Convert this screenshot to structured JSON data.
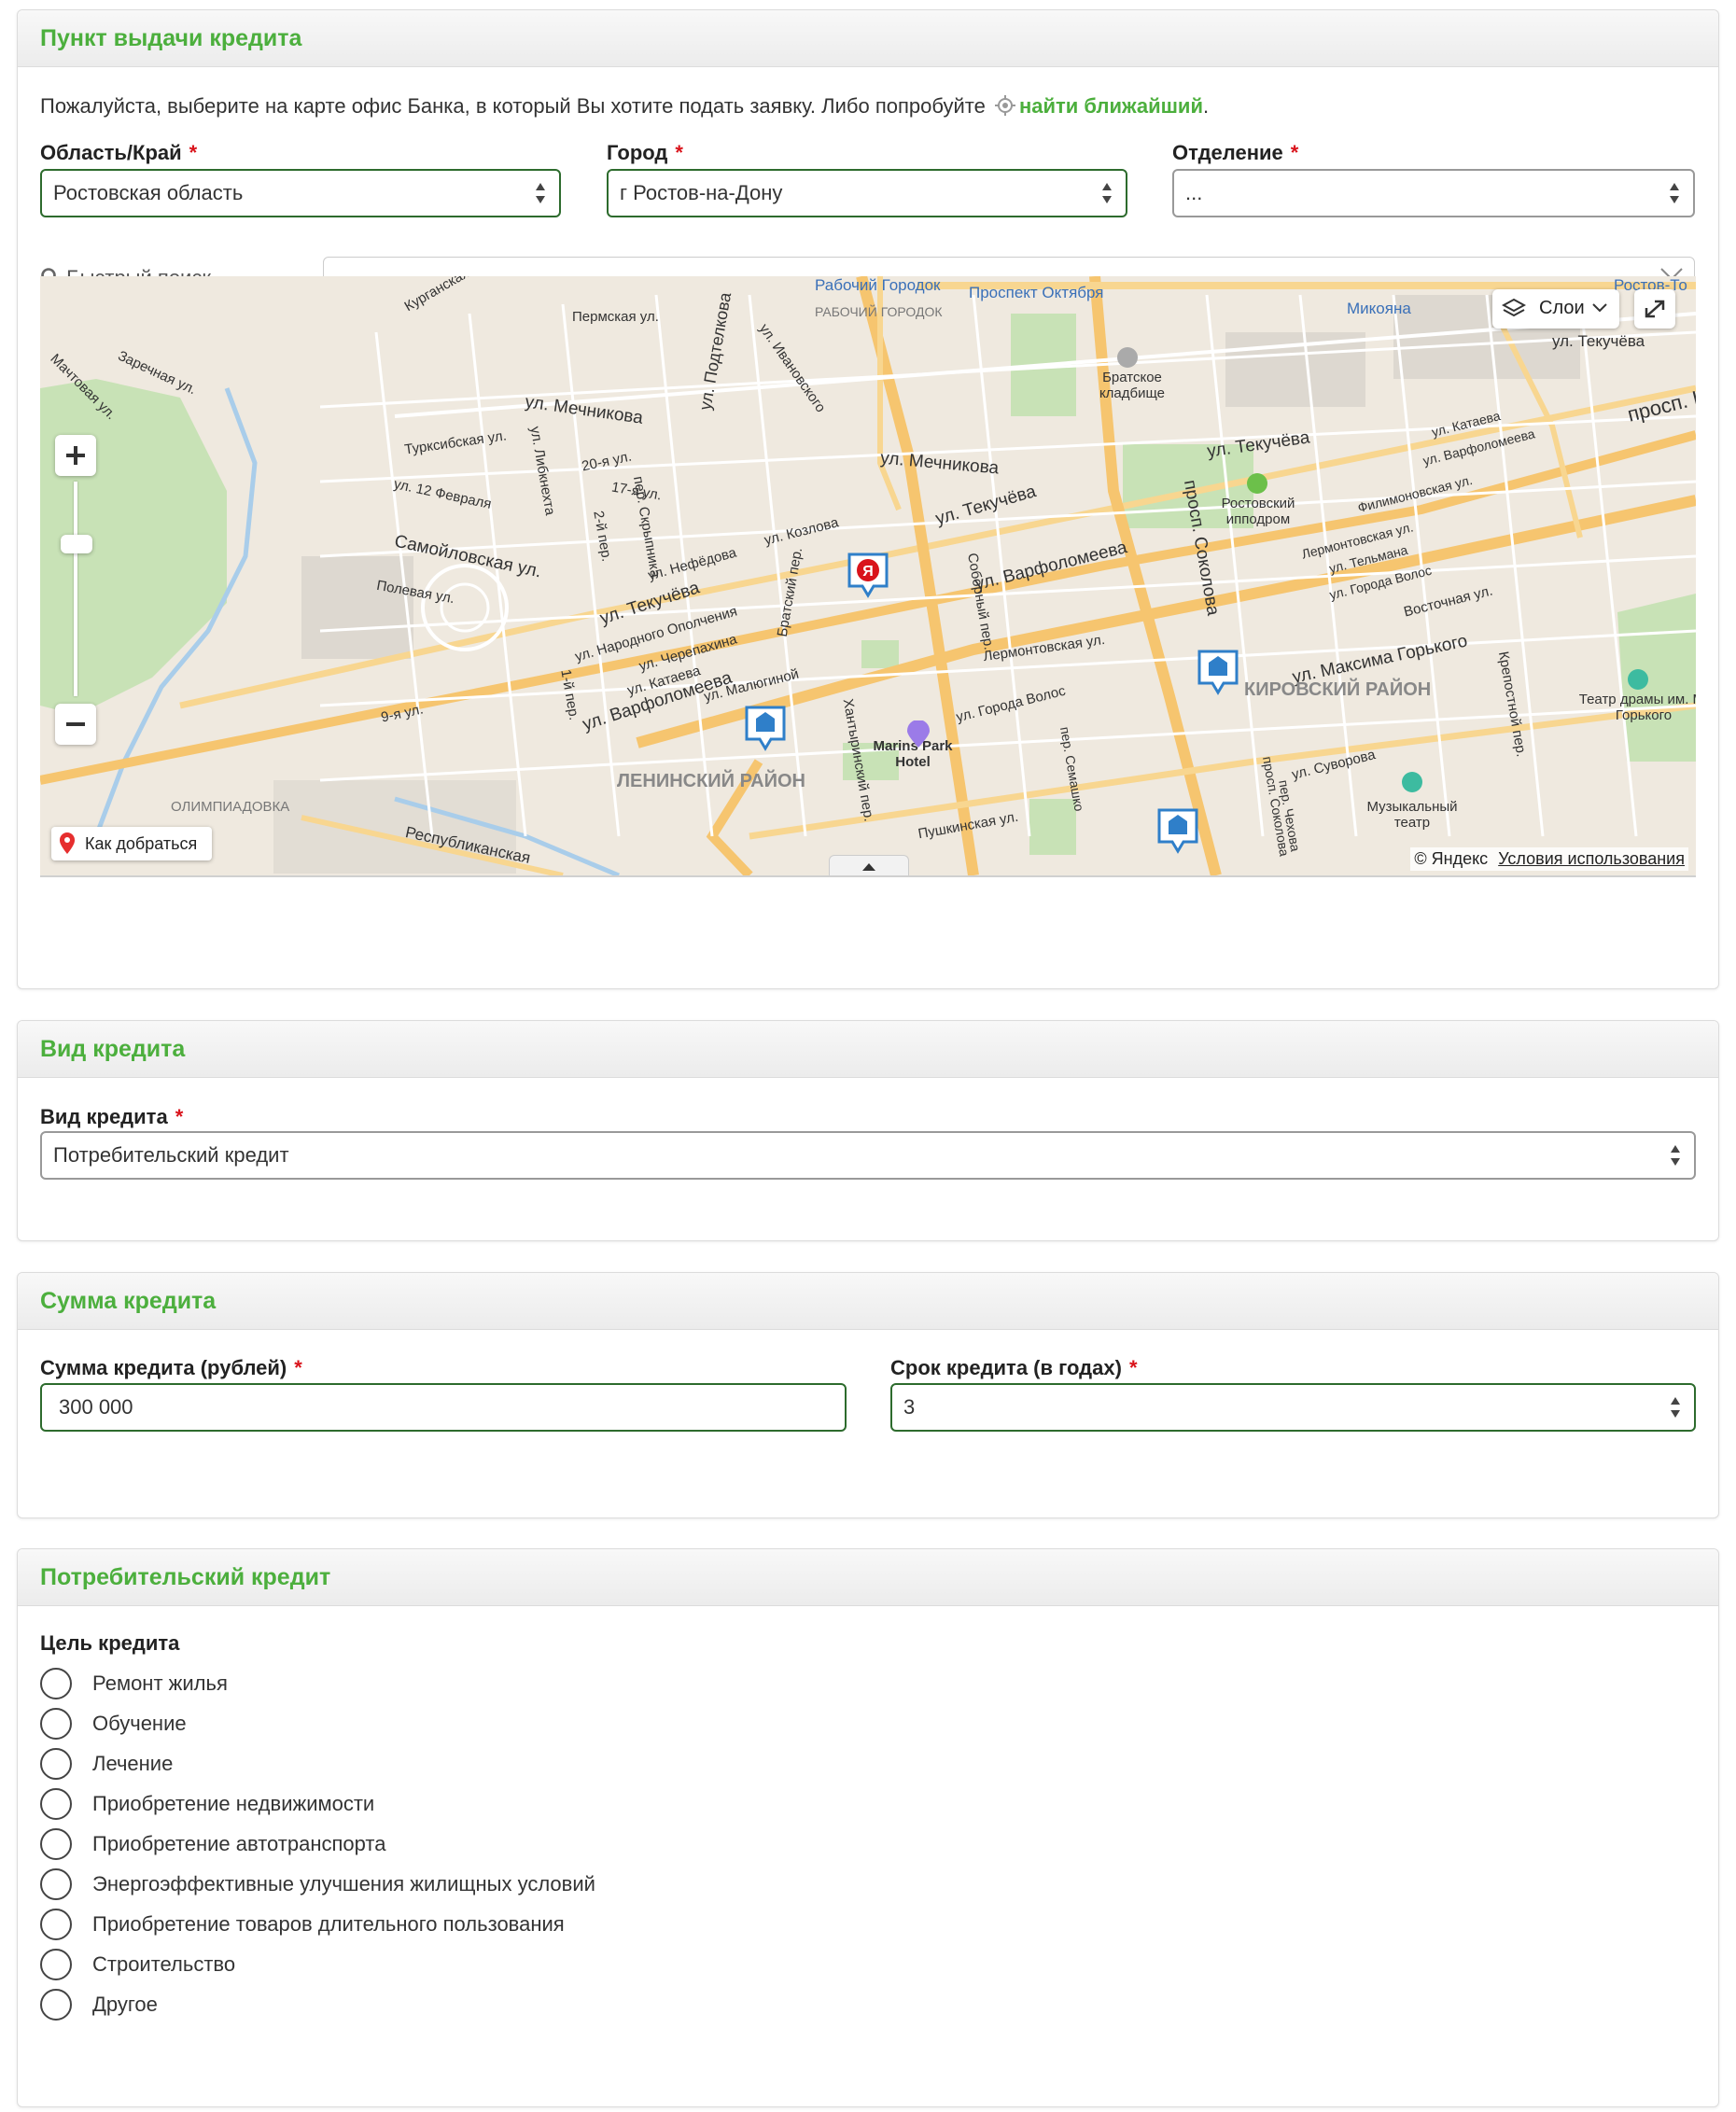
{
  "office_panel": {
    "title": "Пункт выдачи кредита",
    "intro_text": "Пожалуйста, выберите на карте офис Банка, в который Вы хотите подать заявку. Либо попробуйте",
    "find_nearest_label": "найти ближайший",
    "intro_end": ".",
    "region": {
      "label": "Область/Край",
      "value": "Ростовская область"
    },
    "city": {
      "label": "Город",
      "value": "г Ростов-на-Дону"
    },
    "branch": {
      "label": "Отделение",
      "value": "..."
    },
    "quick_search": {
      "label": "Быстрый поиск",
      "value": "..."
    },
    "required_mark": "*",
    "map": {
      "layers_label": "Слои",
      "route_label": "Как добраться",
      "copyright": "© Яндекс",
      "terms": "Условия использования",
      "streets": [
        "ул. Мечникова",
        "ул. Мечникова",
        "ул. Текучёва",
        "ул. Текучёва",
        "ул. Текучёва",
        "ул. Текучёва",
        "ул. Варфоломеева",
        "ул. Варфоломеева",
        "ул. Максима Горького",
        "просп. Соколова",
        "просп. Соколова",
        "Самойловская ул.",
        "ул. Подтелкова",
        "Пермская ул.",
        "ул. Ивановского",
        "Рабочий Городок",
        "Проспект Октября",
        "Микояна",
        "Ростов-То",
        "Братское кладбище",
        "Ростовский ипподром",
        "КИРОВСКИЙ РАЙОН",
        "ЛЕНИНСКИЙ РАЙОН",
        "Marins Park Hotel",
        "Театр драмы им. М. Горького",
        "Музыкальный театр",
        "ОЛИМПИАДОВКА",
        "Республиканская",
        "Пушкинская ул.",
        "Соборный пер.",
        "ул. Суворова",
        "Хантыринский пер.",
        "ул. 12 Февраля",
        "Турксибская ул.",
        "20-я ул.",
        "17-я ул.",
        "Полевая ул.",
        "ул. Козлова",
        "Братский пер.",
        "Лермонтовская ул.",
        "ул. Города Волос",
        "Восточная ул.",
        "Крепостной пер.",
        "Заречная ул.",
        "Мачтовая ул.",
        "Курганская ул.",
        "ул. Нефёдова",
        "ул. Народного Ополчения",
        "ул. Черепахина",
        "ул. Катаева",
        "ул. Малюгиной",
        "1-й пер.",
        "9-я ул.",
        "пер. Скрыпника",
        "2-й пер.",
        "ул. Либкнехта",
        "просп. Ш",
        "ул. Катаева",
        "ул. Варфоломеева",
        "Филимоновская ул.",
        "Лермонтовская ул.",
        "ул. Тельмана",
        "ул. Города Волос",
        "пер. Семашко",
        "пер. Чехова",
        "РАБОЧИЙ ГОРОДОК"
      ]
    }
  },
  "credit_type_panel": {
    "title": "Вид кредита",
    "field_label": "Вид кредита",
    "value": "Потребительский кредит"
  },
  "amount_panel": {
    "title": "Сумма кредита",
    "amount_label": "Сумма кредита (рублей)",
    "amount_value": "300 000",
    "term_label": "Срок кредита (в годах)",
    "term_value": "3"
  },
  "consumer_panel": {
    "title": "Потребительский кредит",
    "purpose_label": "Цель кредита",
    "options": [
      "Ремонт жилья",
      "Обучение",
      "Лечение",
      "Приобретение недвижимости",
      "Приобретение автотранспорта",
      "Энергоэффективные улучшения жилищных условий",
      "Приобретение товаров длительного пользования",
      "Строительство",
      "Другое"
    ]
  },
  "colors": {
    "accent": "#4caf3d",
    "required": "#d9131b",
    "border_active": "#2d6b2d"
  }
}
